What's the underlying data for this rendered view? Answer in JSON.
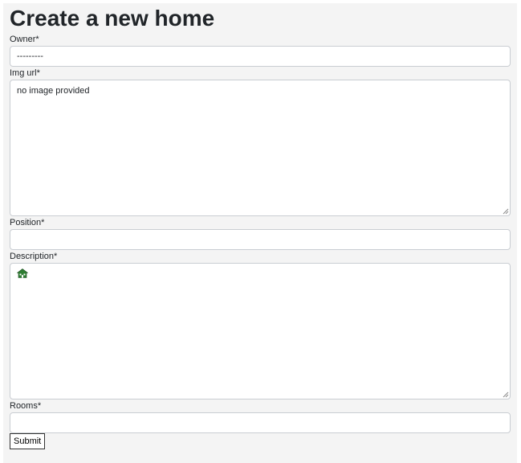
{
  "page": {
    "title": "Create a new home"
  },
  "form": {
    "owner": {
      "label": "Owner*",
      "value": "---------"
    },
    "img_url": {
      "label": "Img url*",
      "value": "no image provided"
    },
    "position": {
      "label": "Position*",
      "value": ""
    },
    "description": {
      "label": "Description*",
      "icon": "home-icon",
      "value": ""
    },
    "rooms": {
      "label": "Rooms*",
      "value": ""
    },
    "submit_label": "Submit"
  },
  "colors": {
    "background": "#f4f4f4",
    "field_border": "#c9cdd2",
    "icon_green": "#2e7d32"
  }
}
